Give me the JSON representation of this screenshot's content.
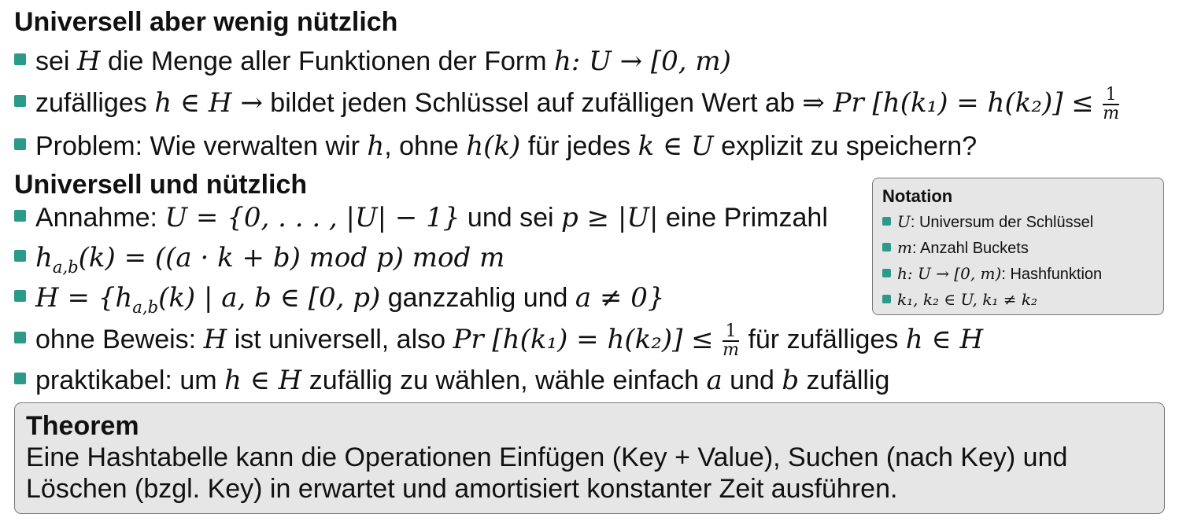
{
  "section1": {
    "heading": "Universell aber wenig nützlich",
    "items": [
      {
        "t1": "sei ",
        "m1": "H",
        "t2": " die Menge aller Funktionen der Form ",
        "m2": "h: U → [0, m)"
      },
      {
        "t1": "zufälliges ",
        "m1": "h ∈ H →",
        "t2": " bildet jeden Schlüssel auf zufälligen Wert ab ",
        "m2": "⇒ Pr [h(k₁) = h(k₂)] ≤",
        "frac_num": "1",
        "frac_den": "m"
      },
      {
        "t1": "Problem: Wie verwalten wir ",
        "m1": "h",
        "t2": ", ohne ",
        "m2": "h(k)",
        "t3": " für jedes ",
        "m3": "k ∈ U",
        "t4": " explizit zu speichern?"
      }
    ]
  },
  "section2": {
    "heading": "Universell und nützlich",
    "items": [
      {
        "t1": "Annahme: ",
        "m1": "U = {0, . . . , |U| − 1}",
        "t2": " und sei ",
        "m2": "p ≥ |U|",
        "t3": " eine Primzahl"
      },
      {
        "m1": "h",
        "sub1": "a,b",
        "m2": "(k) = ((a · k + b) mod p) mod m"
      },
      {
        "m1": "H = {h",
        "sub1": "a,b",
        "m2": "(k) | a, b ∈ [0, p)",
        "t1": " ganzzahlig und ",
        "m3": "a ≠ 0}"
      },
      {
        "t1": "ohne Beweis: ",
        "m1": "H",
        "t2": " ist universell, also ",
        "m2": "Pr [h(k₁) = h(k₂)] ≤",
        "frac_num": "1",
        "frac_den": "m",
        "t3": " für zufälliges ",
        "m3": "h ∈ H"
      },
      {
        "t1": "praktikabel: um ",
        "m1": "h ∈ H",
        "t2": " zufällig zu wählen, wähle einfach ",
        "m2": "a",
        "t3": " und ",
        "m3": "b",
        "t4": " zufällig"
      }
    ]
  },
  "notation": {
    "title": "Notation",
    "items": [
      {
        "m": "U",
        "t": ": Universum der Schlüssel"
      },
      {
        "m": "m",
        "t": ": Anzahl Buckets"
      },
      {
        "m": "h: U → [0, m)",
        "t": ": Hashfunktion"
      },
      {
        "m": "k₁, k₂ ∈ U, k₁ ≠ k₂",
        "t": ""
      }
    ]
  },
  "theorem": {
    "title": "Theorem",
    "line1": "Eine Hashtabelle kann die Operationen Einfügen (Key + Value), Suchen (nach Key) und",
    "line2": "Löschen (bzgl. Key) in erwartet und amortisiert konstanter Zeit ausführen."
  },
  "colors": {
    "bullet": "#2b9a88",
    "box_bg": "#e6e6e6",
    "box_border": "#777777"
  }
}
